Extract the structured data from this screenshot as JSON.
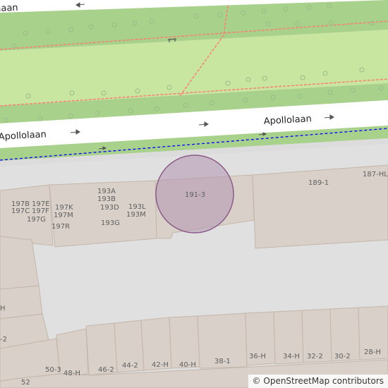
{
  "map": {
    "streets": [
      {
        "name": "Apollolaan"
      },
      {
        "name": "Apollolaan"
      },
      {
        "name": "laan"
      }
    ],
    "marker": {
      "fill": "#b393b0",
      "stroke": "#8a5c87"
    },
    "house_numbers": [
      "197B",
      "197E",
      "197C",
      "197F",
      "197G",
      "197K",
      "197M",
      "197R",
      "193A",
      "193B",
      "193D",
      "193L",
      "193M",
      "193G",
      "191-3",
      "189-1",
      "187-HL",
      "H",
      "-2",
      "50-3",
      "48-H",
      "46-2",
      "44-2",
      "42-H",
      "40-H",
      "38-1",
      "36-H",
      "34-H",
      "32-2",
      "30-2",
      "28-H",
      "52"
    ],
    "colors": {
      "park": "#c8e6a0",
      "verge": "#a8d18b",
      "road": "#ffffff",
      "building": "#d9d0c9",
      "building_edge": "#c3b6ab",
      "landuse": "#e0e0e0",
      "footpath": "#fa8072",
      "cycleway": "#0000ff"
    }
  },
  "attribution": {
    "symbol": "©",
    "text": "OpenStreetMap contributors"
  }
}
